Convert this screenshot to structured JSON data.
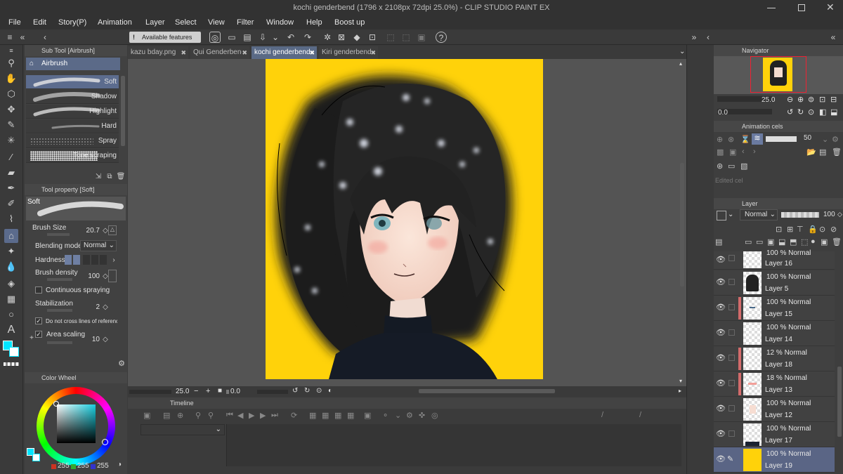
{
  "window": {
    "title": "kochi genderbend (1796 x 2108px 72dpi 25.0%)  - CLIP STUDIO PAINT EX"
  },
  "menu": [
    "File",
    "Edit",
    "Story(P)",
    "Animation",
    "Layer",
    "Select",
    "View",
    "Filter",
    "Window",
    "Help",
    "Boost up"
  ],
  "command_bar": {
    "available_features": "Available features"
  },
  "tabs": [
    {
      "label": "kazu bday.png"
    },
    {
      "label": "Qui Genderbend"
    },
    {
      "label": "kochi genderbend",
      "active": true
    },
    {
      "label": "Kiri genderbend"
    }
  ],
  "sub_tool": {
    "header": "Sub Tool [Airbrush]",
    "group": "Airbrush",
    "brushes": [
      "Soft",
      "Shadow",
      "Highlight",
      "Hard",
      "Spray",
      "Tone scraping"
    ],
    "selected": "Soft"
  },
  "tool_property": {
    "header": "Tool property [Soft]",
    "preview_label": "Soft",
    "brush_size_label": "Brush Size",
    "brush_size": "20.7",
    "blending_mode_label": "Blending mode",
    "blending_mode": "Normal",
    "hardness_label": "Hardness",
    "brush_density_label": "Brush density",
    "brush_density": "100",
    "continuous_spraying": "Continuous spraying",
    "stabilization_label": "Stabilization",
    "stabilization": "2",
    "cross_lines": "Do not cross lines of reference l",
    "area_scaling_label": "Area scaling",
    "area_scaling": "10"
  },
  "color_wheel": {
    "header": "Color Wheel",
    "r": "255",
    "g": "255",
    "b": "255",
    "main_color": "#00e5ff",
    "hue_color": "#18cfe0"
  },
  "canvas": {
    "background": "#ffd20a",
    "zoom": "25.0",
    "rotation": "0.0"
  },
  "timeline": {
    "header": "Timeline"
  },
  "navigator": {
    "header": "Navigator",
    "zoom": "25.0",
    "rotation": "0.0"
  },
  "animation_cels": {
    "header": "Animation cels",
    "opacity": "50",
    "edited_label": "Edited cel"
  },
  "layer_panel": {
    "header": "Layer",
    "blend": "Normal",
    "opacity": "100",
    "layers": [
      {
        "mode": "100 % Normal",
        "name": "Layer 16",
        "red": false
      },
      {
        "mode": "100 % Normal",
        "name": "Layer 5",
        "red": false
      },
      {
        "mode": "100 % Normal",
        "name": "Layer 15",
        "red": true
      },
      {
        "mode": "100 % Normal",
        "name": "Layer 14",
        "red": false
      },
      {
        "mode": "12 % Normal",
        "name": "Layer 18",
        "red": true
      },
      {
        "mode": "18 % Normal",
        "name": "Layer 13",
        "red": true
      },
      {
        "mode": "100 % Normal",
        "name": "Layer 12",
        "red": false
      },
      {
        "mode": "100 % Normal",
        "name": "Layer 17",
        "red": false
      },
      {
        "mode": "100 % Normal",
        "name": "Layer 19",
        "red": false,
        "selected": true
      }
    ]
  }
}
